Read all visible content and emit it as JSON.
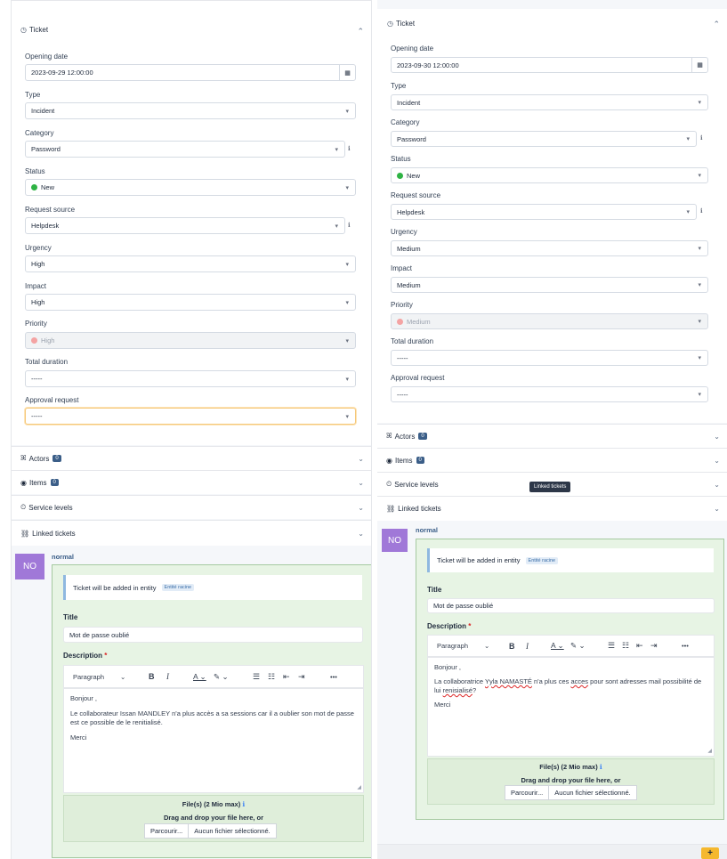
{
  "left": {
    "ticket_header": "Ticket",
    "fields": [
      {
        "label": "Opening date",
        "value": "2023-09-29 12:00:00"
      },
      {
        "label": "Type",
        "value": "Incident"
      },
      {
        "label": "Category",
        "value": "Password"
      },
      {
        "label": "Status",
        "value": "New"
      },
      {
        "label": "Request source",
        "value": "Helpdesk"
      },
      {
        "label": "Urgency",
        "value": "High"
      },
      {
        "label": "Impact",
        "value": "High"
      },
      {
        "label": "Priority",
        "value": "High"
      },
      {
        "label": "Total duration",
        "value": "-----"
      },
      {
        "label": "Approval request",
        "value": "-----"
      }
    ],
    "sections": [
      {
        "label": "Actors",
        "count": "0"
      },
      {
        "label": "Items",
        "count": "0"
      },
      {
        "label": "Service levels"
      },
      {
        "label": "Linked tickets"
      }
    ],
    "avatar": "NO",
    "author": "normal",
    "entity_text": "Ticket will be added in entity",
    "entity_name": "Entité racine",
    "title_label": "Title",
    "title_value": "Mot de passe oublié",
    "description_label": "Description",
    "required_mark": "*",
    "toolbar": {
      "paragraph": "Paragraph",
      "bold": "B",
      "italic": "I",
      "more": "•••"
    },
    "desc_lines": [
      "Bonjour ,",
      "Le collaborateur Issan MANDLEY n'a plus accès a sa sessions car il a oublier son mot de passe est ce possible de le renitialisé.",
      "Merci"
    ],
    "files_label": "File(s) (2 Mio max)",
    "drag_text": "Drag and drop your file here, or",
    "browse": "Parcourir...",
    "no_file": "Aucun fichier sélectionné."
  },
  "right": {
    "ticket_header": "Ticket",
    "fields": [
      {
        "label": "Opening date",
        "value": "2023-09-30 12:00:00"
      },
      {
        "label": "Type",
        "value": "Incident"
      },
      {
        "label": "Category",
        "value": "Password"
      },
      {
        "label": "Status",
        "value": "New"
      },
      {
        "label": "Request source",
        "value": "Helpdesk"
      },
      {
        "label": "Urgency",
        "value": "Medium"
      },
      {
        "label": "Impact",
        "value": "Medium"
      },
      {
        "label": "Priority",
        "value": "Medium"
      },
      {
        "label": "Total duration",
        "value": "-----"
      },
      {
        "label": "Approval request",
        "value": "-----"
      }
    ],
    "sections": [
      {
        "label": "Actors",
        "count": "0"
      },
      {
        "label": "Items",
        "count": "0"
      },
      {
        "label": "Service levels"
      },
      {
        "label": "Linked tickets"
      }
    ],
    "tooltip": "Linked tickets",
    "avatar": "NO",
    "author": "normal",
    "entity_text": "Ticket will be added in entity",
    "entity_name": "Entité racine",
    "title_label": "Title",
    "title_value": "Mot de passe oublié",
    "description_label": "Description",
    "required_mark": "*",
    "toolbar": {
      "paragraph": "Paragraph",
      "bold": "B",
      "italic": "I",
      "more": "•••"
    },
    "desc_lines": [
      "Bonjour ,",
      "Merci"
    ],
    "desc_line2_a": "La collaboratrice ",
    "desc_line2_name": "Yyla NAMASTÉ",
    "desc_line2_b": " n'a plus ces ",
    "desc_line2_acces": "acces",
    "desc_line2_c": "  pour sont adresses mail possibilité de lui ",
    "desc_line2_renis": "renisialisé",
    "desc_line2_d": "?",
    "files_label": "File(s) (2 Mio max)",
    "drag_text": "Drag and drop your file here, or",
    "browse": "Parcourir...",
    "no_file": "Aucun fichier sélectionné.",
    "add_button": "+"
  },
  "colors": {
    "status_new": "#2fb344",
    "priority_dot": "#f4a3a3",
    "green_bg": "#e7f4e4",
    "avatar": "#a078d8",
    "plus": "#f5b82e"
  }
}
